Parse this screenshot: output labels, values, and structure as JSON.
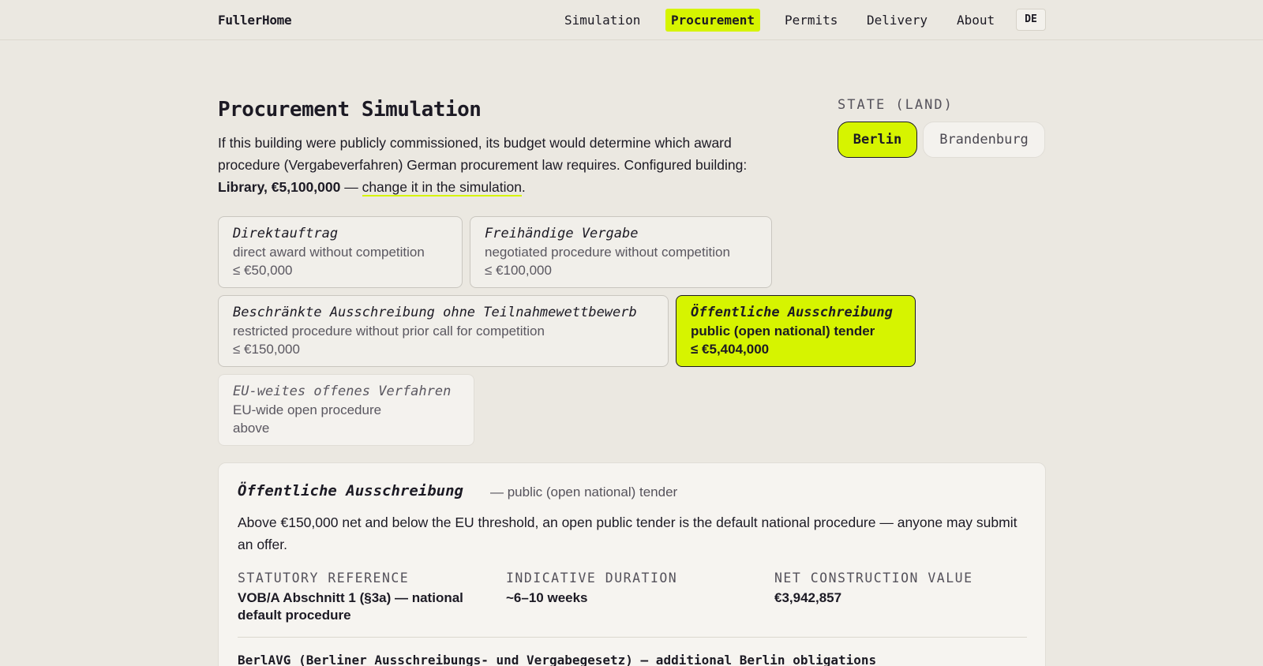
{
  "header": {
    "brand": "FullerHome",
    "nav": [
      {
        "label": "Simulation"
      },
      {
        "label": "Procurement",
        "active": true
      },
      {
        "label": "Permits"
      },
      {
        "label": "Delivery"
      },
      {
        "label": "About"
      }
    ],
    "lang": "DE"
  },
  "intro": {
    "title": "Procurement Simulation",
    "text_1": "If this building were publicly commissioned, its budget would determine which award procedure (Vergabeverfahren) German procurement law requires. Configured building: ",
    "building": "Library, €5,100,000",
    "text_2": " — ",
    "link": "change it in the simulation",
    "text_3": "."
  },
  "state": {
    "label": "STATE (LAND)",
    "options": [
      "Berlin",
      "Brandenburg"
    ],
    "selected": "Berlin"
  },
  "procedures": [
    {
      "name": "Direktauftrag",
      "desc": "direct award without competition",
      "limit": "≤ €50,000"
    },
    {
      "name": "Freihändige Vergabe",
      "desc": "negotiated procedure without competition",
      "limit": "≤ €100,000"
    },
    {
      "name": "Beschränkte Ausschreibung ohne Teilnahmewettbewerb",
      "desc": "restricted procedure without prior call for competition",
      "limit": "≤ €150,000"
    },
    {
      "name": "Öffentliche Ausschreibung",
      "desc": "public (open national) tender",
      "limit": "≤ €5,404,000",
      "active": true
    },
    {
      "name": "EU-weites offenes Verfahren",
      "desc": "EU-wide open procedure",
      "limit": "above"
    }
  ],
  "detail": {
    "name": "Öffentliche Ausschreibung",
    "subtitle": "— public (open national) tender",
    "text": "Above €150,000 net and below the EU threshold, an open public tender is the default national procedure — anyone may submit an offer.",
    "meta": [
      {
        "label": "STATUTORY REFERENCE",
        "value": "VOB/A Abschnitt 1 (§3a) — national default procedure"
      },
      {
        "label": "INDICATIVE DURATION",
        "value": "~6–10 weeks"
      },
      {
        "label": "NET CONSTRUCTION VALUE",
        "value": "€3,942,857"
      }
    ],
    "berl": "BerlAVG (Berliner Ausschreibungs- und Vergabegesetz) — additional Berlin obligations"
  },
  "colors": {
    "accent": "#d6f400",
    "background": "#ebe8e1",
    "panel": "#f6f4f0",
    "text": "#1c1a24"
  }
}
